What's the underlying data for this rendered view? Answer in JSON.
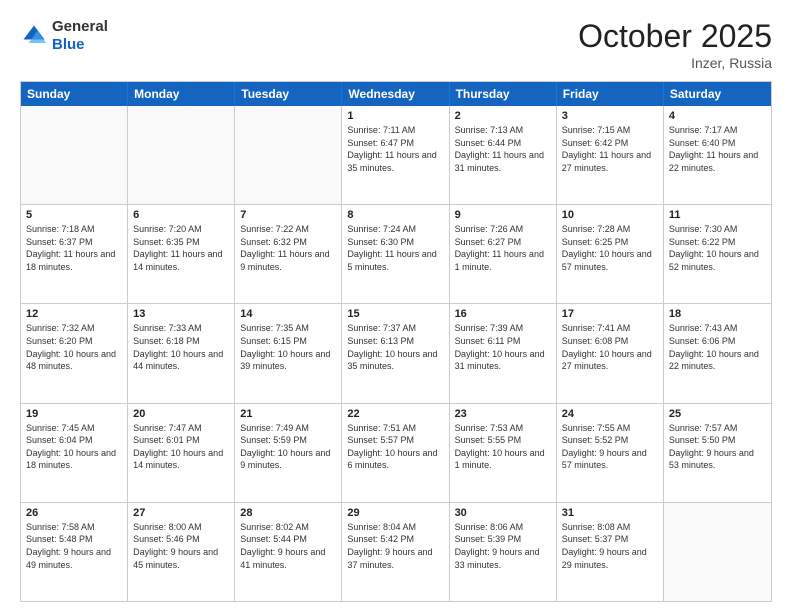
{
  "header": {
    "logo_general": "General",
    "logo_blue": "Blue",
    "month_title": "October 2025",
    "location": "Inzer, Russia"
  },
  "weekdays": [
    "Sunday",
    "Monday",
    "Tuesday",
    "Wednesday",
    "Thursday",
    "Friday",
    "Saturday"
  ],
  "rows": [
    [
      {
        "day": "",
        "empty": true
      },
      {
        "day": "",
        "empty": true
      },
      {
        "day": "",
        "empty": true
      },
      {
        "day": "1",
        "sunrise": "7:11 AM",
        "sunset": "6:47 PM",
        "daylight": "11 hours and 35 minutes."
      },
      {
        "day": "2",
        "sunrise": "7:13 AM",
        "sunset": "6:44 PM",
        "daylight": "11 hours and 31 minutes."
      },
      {
        "day": "3",
        "sunrise": "7:15 AM",
        "sunset": "6:42 PM",
        "daylight": "11 hours and 27 minutes."
      },
      {
        "day": "4",
        "sunrise": "7:17 AM",
        "sunset": "6:40 PM",
        "daylight": "11 hours and 22 minutes."
      }
    ],
    [
      {
        "day": "5",
        "sunrise": "7:18 AM",
        "sunset": "6:37 PM",
        "daylight": "11 hours and 18 minutes."
      },
      {
        "day": "6",
        "sunrise": "7:20 AM",
        "sunset": "6:35 PM",
        "daylight": "11 hours and 14 minutes."
      },
      {
        "day": "7",
        "sunrise": "7:22 AM",
        "sunset": "6:32 PM",
        "daylight": "11 hours and 9 minutes."
      },
      {
        "day": "8",
        "sunrise": "7:24 AM",
        "sunset": "6:30 PM",
        "daylight": "11 hours and 5 minutes."
      },
      {
        "day": "9",
        "sunrise": "7:26 AM",
        "sunset": "6:27 PM",
        "daylight": "11 hours and 1 minute."
      },
      {
        "day": "10",
        "sunrise": "7:28 AM",
        "sunset": "6:25 PM",
        "daylight": "10 hours and 57 minutes."
      },
      {
        "day": "11",
        "sunrise": "7:30 AM",
        "sunset": "6:22 PM",
        "daylight": "10 hours and 52 minutes."
      }
    ],
    [
      {
        "day": "12",
        "sunrise": "7:32 AM",
        "sunset": "6:20 PM",
        "daylight": "10 hours and 48 minutes."
      },
      {
        "day": "13",
        "sunrise": "7:33 AM",
        "sunset": "6:18 PM",
        "daylight": "10 hours and 44 minutes."
      },
      {
        "day": "14",
        "sunrise": "7:35 AM",
        "sunset": "6:15 PM",
        "daylight": "10 hours and 39 minutes."
      },
      {
        "day": "15",
        "sunrise": "7:37 AM",
        "sunset": "6:13 PM",
        "daylight": "10 hours and 35 minutes."
      },
      {
        "day": "16",
        "sunrise": "7:39 AM",
        "sunset": "6:11 PM",
        "daylight": "10 hours and 31 minutes."
      },
      {
        "day": "17",
        "sunrise": "7:41 AM",
        "sunset": "6:08 PM",
        "daylight": "10 hours and 27 minutes."
      },
      {
        "day": "18",
        "sunrise": "7:43 AM",
        "sunset": "6:06 PM",
        "daylight": "10 hours and 22 minutes."
      }
    ],
    [
      {
        "day": "19",
        "sunrise": "7:45 AM",
        "sunset": "6:04 PM",
        "daylight": "10 hours and 18 minutes."
      },
      {
        "day": "20",
        "sunrise": "7:47 AM",
        "sunset": "6:01 PM",
        "daylight": "10 hours and 14 minutes."
      },
      {
        "day": "21",
        "sunrise": "7:49 AM",
        "sunset": "5:59 PM",
        "daylight": "10 hours and 9 minutes."
      },
      {
        "day": "22",
        "sunrise": "7:51 AM",
        "sunset": "5:57 PM",
        "daylight": "10 hours and 6 minutes."
      },
      {
        "day": "23",
        "sunrise": "7:53 AM",
        "sunset": "5:55 PM",
        "daylight": "10 hours and 1 minute."
      },
      {
        "day": "24",
        "sunrise": "7:55 AM",
        "sunset": "5:52 PM",
        "daylight": "9 hours and 57 minutes."
      },
      {
        "day": "25",
        "sunrise": "7:57 AM",
        "sunset": "5:50 PM",
        "daylight": "9 hours and 53 minutes."
      }
    ],
    [
      {
        "day": "26",
        "sunrise": "7:58 AM",
        "sunset": "5:48 PM",
        "daylight": "9 hours and 49 minutes."
      },
      {
        "day": "27",
        "sunrise": "8:00 AM",
        "sunset": "5:46 PM",
        "daylight": "9 hours and 45 minutes."
      },
      {
        "day": "28",
        "sunrise": "8:02 AM",
        "sunset": "5:44 PM",
        "daylight": "9 hours and 41 minutes."
      },
      {
        "day": "29",
        "sunrise": "8:04 AM",
        "sunset": "5:42 PM",
        "daylight": "9 hours and 37 minutes."
      },
      {
        "day": "30",
        "sunrise": "8:06 AM",
        "sunset": "5:39 PM",
        "daylight": "9 hours and 33 minutes."
      },
      {
        "day": "31",
        "sunrise": "8:08 AM",
        "sunset": "5:37 PM",
        "daylight": "9 hours and 29 minutes."
      },
      {
        "day": "",
        "empty": true
      }
    ]
  ]
}
